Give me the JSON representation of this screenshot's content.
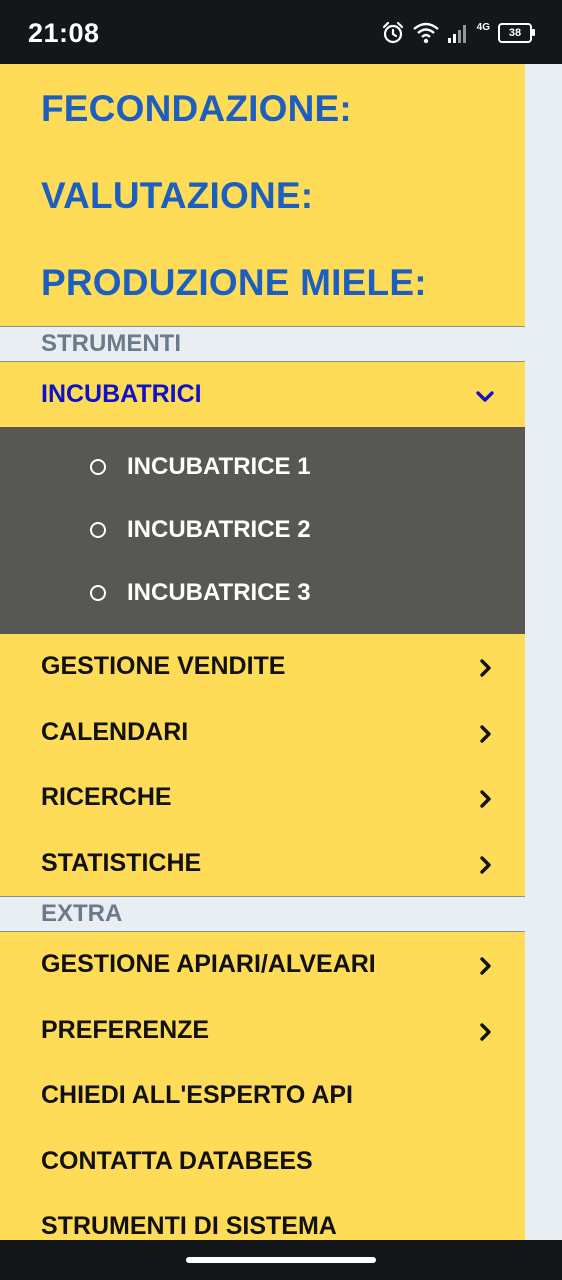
{
  "status_bar": {
    "time": "21:08",
    "network": "4G",
    "battery": "38",
    "icons": [
      "alarm-icon",
      "wifi-icon",
      "signal-icon",
      "battery-icon"
    ]
  },
  "categories": [
    {
      "label": "FECONDAZIONE:"
    },
    {
      "label": "VALUTAZIONE:"
    },
    {
      "label": "PRODUZIONE MIELE:"
    }
  ],
  "sections": {
    "strumenti": "STRUMENTI",
    "extra": "EXTRA"
  },
  "strumenti_items": {
    "active": {
      "label": "INCUBATRICI",
      "icon": "chevron-down-icon"
    },
    "submenu": [
      {
        "label": "INCUBATRICE 1"
      },
      {
        "label": "INCUBATRICE 2"
      },
      {
        "label": "INCUBATRICE 3"
      }
    ],
    "items": [
      {
        "label": "GESTIONE VENDITE",
        "icon": "chevron-right-icon"
      },
      {
        "label": "CALENDARI",
        "icon": "chevron-right-icon"
      },
      {
        "label": "RICERCHE",
        "icon": "chevron-right-icon"
      },
      {
        "label": "STATISTICHE",
        "icon": "chevron-right-icon"
      }
    ]
  },
  "extra_items": [
    {
      "label": "GESTIONE APIARI/ALVEARI",
      "icon": "chevron-right-icon"
    },
    {
      "label": "PREFERENZE",
      "icon": "chevron-right-icon"
    },
    {
      "label": "CHIEDI ALL'ESPERTO API"
    },
    {
      "label": "CONTATTA DATABEES"
    },
    {
      "label": "STRUMENTI DI SISTEMA"
    }
  ],
  "colors": {
    "drawer_bg": "#ffdc57",
    "category_text": "#1c5fbf",
    "active_text": "#1010c8",
    "submenu_bg": "#575854",
    "section_bg": "#e9eef3",
    "section_text": "#6b7b8c"
  }
}
